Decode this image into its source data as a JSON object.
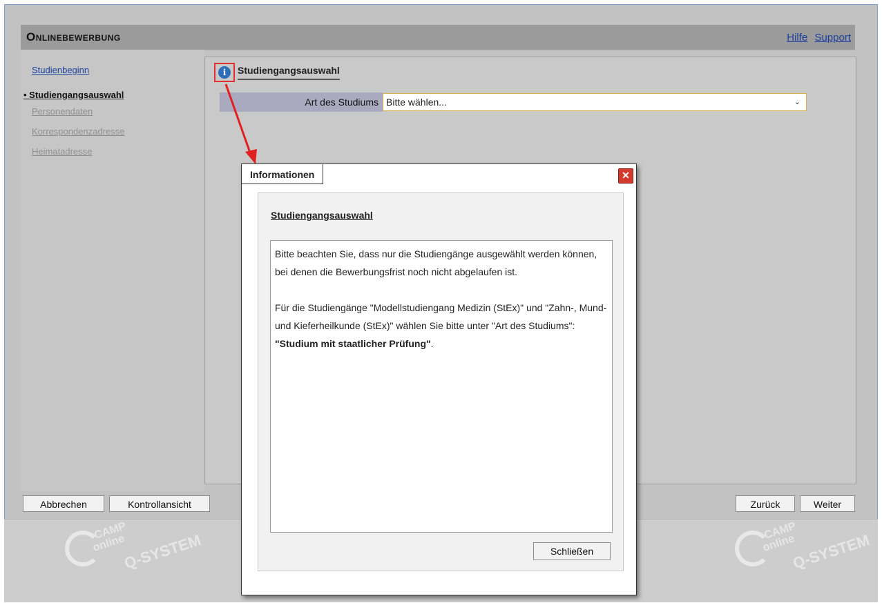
{
  "header": {
    "title": "Onlinebewerbung",
    "links": [
      "Hilfe",
      "Support"
    ]
  },
  "nav": {
    "items": [
      {
        "label": "Studienbeginn",
        "state": "link"
      },
      {
        "label": "Studiengangsauswahl",
        "state": "active"
      },
      {
        "label": "Personendaten",
        "state": "disabled"
      },
      {
        "label": "Korrespondenzadresse",
        "state": "disabled"
      },
      {
        "label": "Heimatadresse",
        "state": "disabled"
      }
    ]
  },
  "section": {
    "title": "Studiengangsauswahl",
    "field_label": "Art des Studiums",
    "field_value": "Bitte wählen..."
  },
  "buttons": {
    "cancel": "Abbrechen",
    "overview": "Kontrollansicht",
    "back": "Zurück",
    "next": "Weiter"
  },
  "modal": {
    "tab": "Informationen",
    "close_icon": "close-x",
    "heading": "Studiengangsauswahl",
    "para1": "Bitte beachten Sie, dass nur die Studiengänge ausgewählt werden können, bei denen die Bewerbungsfrist noch nicht abgelaufen ist.",
    "para2_prefix": "Für die Studiengänge \"Modellstudiengang Medizin (StEx)\" und \"Zahn-, Mund- und Kieferheilkunde (StEx)\" wählen Sie bitte unter \"Art des Studiums\": ",
    "para2_bold": "\"Studium mit staatlicher Prüfung\"",
    "para2_suffix": ".",
    "close_button": "Schließen"
  },
  "watermark": {
    "line1": "CAMP",
    "line2": "online",
    "line3": "Q-SYSTEM"
  },
  "colors": {
    "annotation_red": "#e02020",
    "info_blue": "#2d6fb8",
    "link_blue": "#1a3f9c"
  }
}
